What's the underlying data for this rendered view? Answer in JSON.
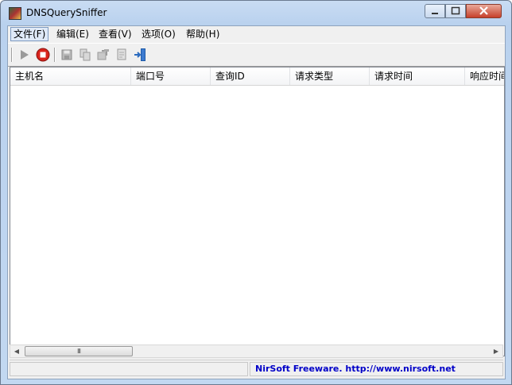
{
  "window": {
    "title": "DNSQuerySniffer"
  },
  "menu": [
    "文件(F)",
    "编辑(E)",
    "查看(V)",
    "选项(O)",
    "帮助(H)"
  ],
  "toolbar": {
    "buttons": [
      "play-icon",
      "stop-icon",
      "save-icon",
      "copy-icon",
      "properties-icon",
      "html-report-icon",
      "exit-icon"
    ]
  },
  "columns": [
    "主机名",
    "端口号",
    "查询ID",
    "请求类型",
    "请求时间",
    "响应时间"
  ],
  "scrollbar": {
    "thumb_grip": "III"
  },
  "status": {
    "left": "",
    "right": "NirSoft Freeware.  http://www.nirsoft.net"
  },
  "colors": {
    "accent": "#0000c8",
    "stop_red": "#d9241c"
  }
}
